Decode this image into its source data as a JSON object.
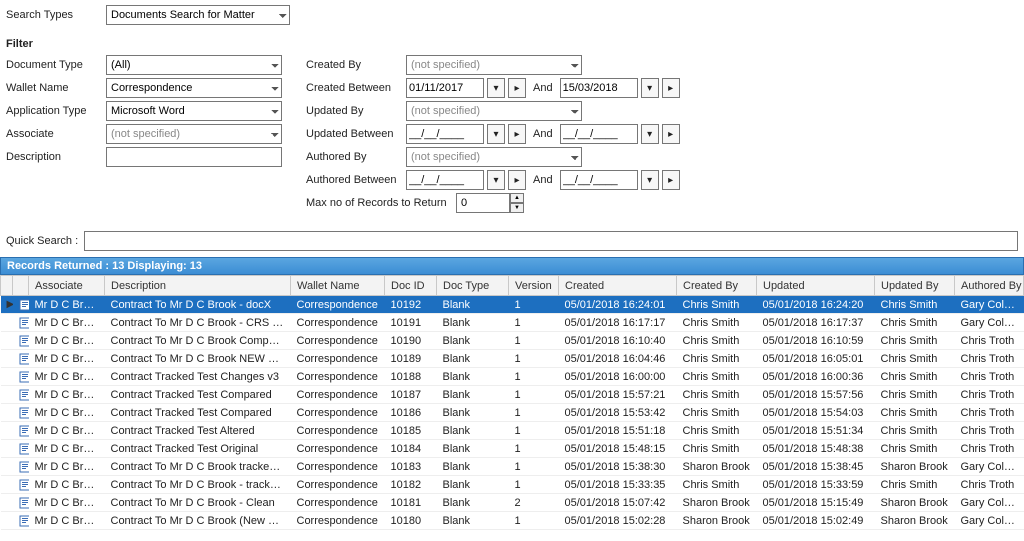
{
  "searchTypes": {
    "label": "Search Types",
    "value": "Documents Search for Matter"
  },
  "filter": {
    "heading": "Filter",
    "documentType": {
      "label": "Document Type",
      "value": "(All)"
    },
    "walletName": {
      "label": "Wallet Name",
      "value": "Correspondence"
    },
    "applicationType": {
      "label": "Application Type",
      "value": "Microsoft Word"
    },
    "associate": {
      "label": "Associate",
      "value": "(not specified)"
    },
    "description": {
      "label": "Description",
      "value": ""
    },
    "createdBy": {
      "label": "Created By",
      "value": "(not specified)"
    },
    "createdBetween": {
      "label": "Created Between",
      "from": "01/11/2017",
      "to": "15/03/2018",
      "and": "And"
    },
    "updatedBy": {
      "label": "Updated By",
      "value": "(not specified)"
    },
    "updatedBetween": {
      "label": "Updated Between",
      "from": "__/__/____",
      "to": "__/__/____",
      "and": "And"
    },
    "authoredBy": {
      "label": "Authored By",
      "value": "(not specified)"
    },
    "authoredBetween": {
      "label": "Authored Between",
      "from": "__/__/____",
      "to": "__/__/____",
      "and": "And"
    },
    "maxRecords": {
      "label": "Max no of Records to Return",
      "value": "0"
    }
  },
  "quickSearch": {
    "label": "Quick Search :",
    "value": ""
  },
  "status": {
    "text": "Records Returned : 13  Displaying: 13"
  },
  "columns": [
    "Associate",
    "Description",
    "Wallet Name",
    "Doc ID",
    "Doc Type",
    "Version",
    "Created",
    "Created By",
    "Updated",
    "Updated By",
    "Authored By"
  ],
  "rows": [
    {
      "sel": true,
      "assoc": "Mr D C Brook",
      "desc": "Contract To Mr D C Brook - docX",
      "wallet": "Correspondence",
      "docid": "10192",
      "doctype": "Blank",
      "ver": "1",
      "created": "05/01/2018 16:24:01",
      "cby": "Chris Smith",
      "updated": "05/01/2018 16:24:20",
      "uby": "Chris Smith",
      "aby": "Gary Colclough"
    },
    {
      "sel": false,
      "assoc": "Mr D C Brook",
      "desc": "Contract To Mr D C Brook - CRS works",
      "wallet": "Correspondence",
      "docid": "10191",
      "doctype": "Blank",
      "ver": "1",
      "created": "05/01/2018 16:17:17",
      "cby": "Chris Smith",
      "updated": "05/01/2018 16:17:37",
      "uby": "Chris Smith",
      "aby": "Gary Colclough"
    },
    {
      "sel": false,
      "assoc": "Mr D C Brook",
      "desc": "Contract To Mr D C Brook Compare doc",
      "wallet": "Correspondence",
      "docid": "10190",
      "doctype": "Blank",
      "ver": "1",
      "created": "05/01/2018 16:10:40",
      "cby": "Chris Smith",
      "updated": "05/01/2018 16:10:59",
      "uby": "Chris Smith",
      "aby": "Chris Troth"
    },
    {
      "sel": false,
      "assoc": "Mr D C Brook",
      "desc": "Contract To Mr D C Brook NEW NEW",
      "wallet": "Correspondence",
      "docid": "10189",
      "doctype": "Blank",
      "ver": "1",
      "created": "05/01/2018 16:04:46",
      "cby": "Chris Smith",
      "updated": "05/01/2018 16:05:01",
      "uby": "Chris Smith",
      "aby": "Chris Troth"
    },
    {
      "sel": false,
      "assoc": "Mr D C Brook",
      "desc": "Contract Tracked Test Changes v3",
      "wallet": "Correspondence",
      "docid": "10188",
      "doctype": "Blank",
      "ver": "1",
      "created": "05/01/2018 16:00:00",
      "cby": "Chris Smith",
      "updated": "05/01/2018 16:00:36",
      "uby": "Chris Smith",
      "aby": "Chris Troth"
    },
    {
      "sel": false,
      "assoc": "Mr D C Brook",
      "desc": "Contract Tracked Test Compared",
      "wallet": "Correspondence",
      "docid": "10187",
      "doctype": "Blank",
      "ver": "1",
      "created": "05/01/2018 15:57:21",
      "cby": "Chris Smith",
      "updated": "05/01/2018 15:57:56",
      "uby": "Chris Smith",
      "aby": "Chris Troth"
    },
    {
      "sel": false,
      "assoc": "Mr D C Brook",
      "desc": "Contract Tracked Test Compared",
      "wallet": "Correspondence",
      "docid": "10186",
      "doctype": "Blank",
      "ver": "1",
      "created": "05/01/2018 15:53:42",
      "cby": "Chris Smith",
      "updated": "05/01/2018 15:54:03",
      "uby": "Chris Smith",
      "aby": "Chris Troth"
    },
    {
      "sel": false,
      "assoc": "Mr D C Brook",
      "desc": "Contract Tracked Test Altered",
      "wallet": "Correspondence",
      "docid": "10185",
      "doctype": "Blank",
      "ver": "1",
      "created": "05/01/2018 15:51:18",
      "cby": "Chris Smith",
      "updated": "05/01/2018 15:51:34",
      "uby": "Chris Smith",
      "aby": "Chris Troth"
    },
    {
      "sel": false,
      "assoc": "Mr D C Brook",
      "desc": "Contract Tracked Test Original",
      "wallet": "Correspondence",
      "docid": "10184",
      "doctype": "Blank",
      "ver": "1",
      "created": "05/01/2018 15:48:15",
      "cby": "Chris Smith",
      "updated": "05/01/2018 15:48:38",
      "uby": "Chris Smith",
      "aby": "Chris Troth"
    },
    {
      "sel": false,
      "assoc": "Mr D C Brook",
      "desc": "Contract To Mr D C Brook tracked slb",
      "wallet": "Correspondence",
      "docid": "10183",
      "doctype": "Blank",
      "ver": "1",
      "created": "05/01/2018 15:38:30",
      "cby": "Sharon Brook",
      "updated": "05/01/2018 15:38:45",
      "uby": "Sharon Brook",
      "aby": "Gary Colclough"
    },
    {
      "sel": false,
      "assoc": "Mr D C Brook",
      "desc": "Contract To Mr D C Brook - tracked crs",
      "wallet": "Correspondence",
      "docid": "10182",
      "doctype": "Blank",
      "ver": "1",
      "created": "05/01/2018 15:33:35",
      "cby": "Chris Smith",
      "updated": "05/01/2018 15:33:59",
      "uby": "Chris Smith",
      "aby": "Chris Troth"
    },
    {
      "sel": false,
      "assoc": "Mr D C Brook",
      "desc": "Contract To Mr D C Brook - Clean",
      "wallet": "Correspondence",
      "docid": "10181",
      "doctype": "Blank",
      "ver": "2",
      "created": "05/01/2018 15:07:42",
      "cby": "Sharon Brook",
      "updated": "05/01/2018 15:15:49",
      "uby": "Sharon Brook",
      "aby": "Gary Colclough"
    },
    {
      "sel": false,
      "assoc": "Mr D C Brook",
      "desc": "Contract To Mr D C Brook (New Version)",
      "wallet": "Correspondence",
      "docid": "10180",
      "doctype": "Blank",
      "ver": "1",
      "created": "05/01/2018 15:02:28",
      "cby": "Sharon Brook",
      "updated": "05/01/2018 15:02:49",
      "uby": "Sharon Brook",
      "aby": "Gary Colclough"
    }
  ]
}
